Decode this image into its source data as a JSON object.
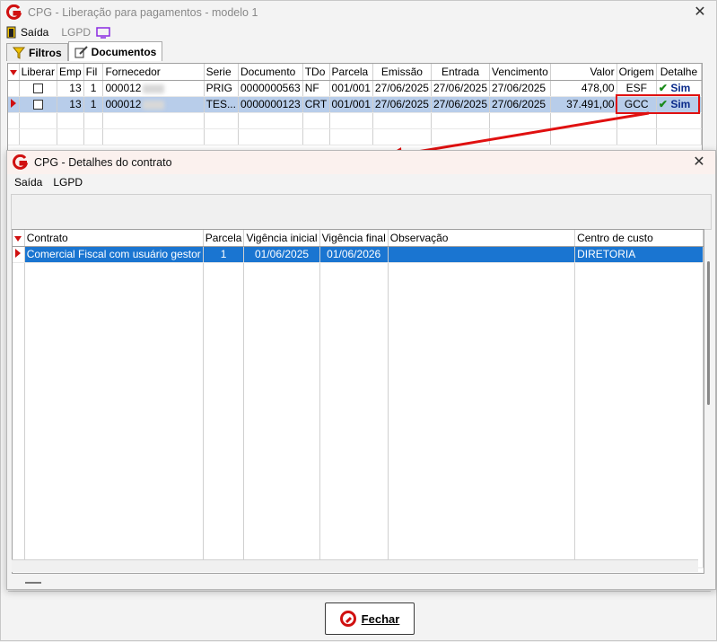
{
  "main_window": {
    "title": "CPG - Liberação para pagamentos - modelo 1",
    "menu": {
      "exit": "Saída",
      "lgpd": "LGPD"
    },
    "tabs": [
      {
        "label": "Filtros"
      },
      {
        "label": "Documentos"
      }
    ],
    "grid": {
      "columns": [
        "Liberar",
        "Emp",
        "Fil",
        "Fornecedor",
        "Serie",
        "Documento",
        "TDo",
        "Parcela",
        "Emissão",
        "Entrada",
        "Vencimento",
        "Valor",
        "Origem",
        "Detalhe"
      ],
      "rows": [
        {
          "emp": "13",
          "fil": "1",
          "fornecedor": "000012",
          "serie": "PRIG",
          "documento": "0000000563",
          "tdo": "NF",
          "parcela": "001/001",
          "emissao": "27/06/2025",
          "entrada": "27/06/2025",
          "vencimento": "27/06/2025",
          "valor": "478,00",
          "origem": "ESF",
          "detalhe": "Sim"
        },
        {
          "emp": "13",
          "fil": "1",
          "fornecedor": "000012",
          "serie": "TES...",
          "documento": "0000000123",
          "tdo": "CRT",
          "parcela": "001/001",
          "emissao": "27/06/2025",
          "entrada": "27/06/2025",
          "vencimento": "27/06/2025",
          "valor": "37.491,00",
          "origem": "GCC",
          "detalhe": "Sim"
        }
      ]
    },
    "close_button": "Fechar"
  },
  "dialog": {
    "title": "CPG - Detalhes do contrato",
    "menu": {
      "exit": "Saída",
      "lgpd": "LGPD"
    },
    "grid": {
      "columns": [
        "Contrato",
        "Parcela",
        "Vigência inicial",
        "Vigência final",
        "Observação",
        "Centro de custo"
      ],
      "rows": [
        {
          "contrato": "Comercial Fiscal com usuário gestor",
          "parcela": "1",
          "vigencia_inicial": "01/06/2025",
          "vigencia_final": "01/06/2026",
          "observacao": "",
          "centro_custo": "DIRETORIA"
        }
      ]
    }
  },
  "colors": {
    "accent_red": "#d01010",
    "selection_blue": "#1a75d1",
    "selection_light": "#b8cdea"
  }
}
